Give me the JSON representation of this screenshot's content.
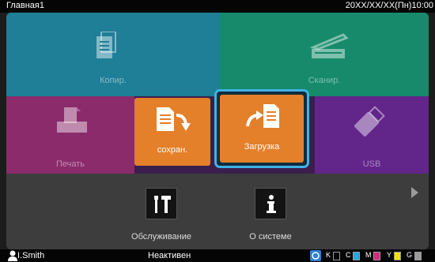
{
  "topbar": {
    "title": "Главная1",
    "clock": "20XX/XX/XX(Пн)10:00"
  },
  "tiles": {
    "copy": {
      "label": "Копир.",
      "icon": "copy-document-icon",
      "color": "#1e7f97"
    },
    "scan": {
      "label": "Сканир.",
      "icon": "scanner-icon",
      "color": "#168a6b"
    },
    "print": {
      "label": "Печать",
      "icon": "printer-tray-icon",
      "color": "#8b2b6c"
    },
    "usb": {
      "label": "USB",
      "icon": "usb-drive-icon",
      "color": "#62258a"
    }
  },
  "popup": {
    "save": {
      "label": "сохран.",
      "icon": "save-document-icon"
    },
    "load": {
      "label": "Загрузка",
      "icon": "load-document-icon",
      "selected": true
    }
  },
  "tools": {
    "maintenance": {
      "label": "Обслуживание",
      "icon": "tools-icon"
    },
    "system": {
      "label": "О системе",
      "icon": "info-icon"
    }
  },
  "status": {
    "user": "I.Smith",
    "state": "Неактивен",
    "inks": [
      {
        "letter": "K",
        "color": "#111111"
      },
      {
        "letter": "C",
        "color": "#21a8e0"
      },
      {
        "letter": "M",
        "color": "#d4287e"
      },
      {
        "letter": "Y",
        "color": "#f2e200"
      },
      {
        "letter": "G",
        "color": "#9a9a9a"
      }
    ]
  }
}
